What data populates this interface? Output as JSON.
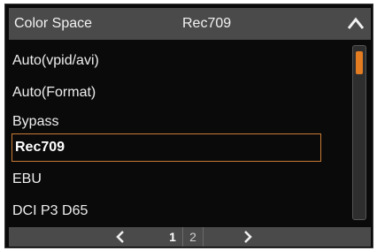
{
  "header": {
    "title": "Color Space",
    "current_value": "Rec709",
    "collapse_icon": "chevron-up-icon"
  },
  "options": [
    {
      "label": "Auto(vpid/avi)",
      "selected": false
    },
    {
      "label": "Auto(Format)",
      "selected": false
    },
    {
      "label": "Bypass",
      "selected": false
    },
    {
      "label": "Rec709",
      "selected": true
    },
    {
      "label": "EBU",
      "selected": false
    },
    {
      "label": "DCI P3 D65",
      "selected": false
    }
  ],
  "pagination": {
    "prev_icon": "chevron-left-icon",
    "next_icon": "chevron-right-icon",
    "pages": [
      "1",
      "2"
    ],
    "current_page": "1"
  },
  "colors": {
    "accent": "#e47c22",
    "selection_border": "#c97a34",
    "header_bg": "#4a4a4a",
    "panel_bg": "#0a0a0a"
  }
}
